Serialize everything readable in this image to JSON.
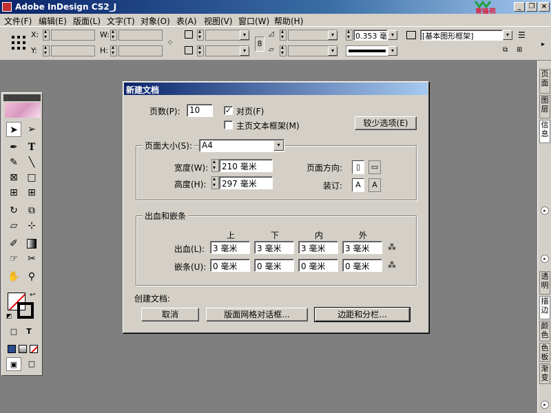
{
  "app": {
    "title": "Adobe InDesign CS2_J",
    "logo": "青锋苑"
  },
  "menu": [
    {
      "label": "文件(F)"
    },
    {
      "label": "编辑(E)"
    },
    {
      "label": "版面(L)"
    },
    {
      "label": "文字(T)"
    },
    {
      "label": "对象(O)"
    },
    {
      "label": "表(A)"
    },
    {
      "label": "视图(V)"
    },
    {
      "label": "窗口(W)"
    },
    {
      "label": "帮助(H)"
    }
  ],
  "control": {
    "x_label": "X:",
    "y_label": "Y:",
    "w_label": "W:",
    "h_label": "H:",
    "stroke_weight": "0.353 毫",
    "frame_style": "[基本图形框架]"
  },
  "dock": {
    "tabs_top": [
      "页面",
      "图层",
      "信息"
    ],
    "tabs_bottom": [
      "透明",
      "描边",
      "颜色",
      "色板",
      "渐变"
    ]
  },
  "dialog": {
    "title": "新建文档",
    "pages_label": "页数(P):",
    "pages_value": "10",
    "facing_label": "对页(F)",
    "facing_checked": "✓",
    "master_text_label": "主页文本框架(M)",
    "fewer_options_label": "较少选项(E)",
    "page_size_label": "页面大小(S):",
    "page_size_value": "A4",
    "width_label": "宽度(W):",
    "width_value": "210 毫米",
    "height_label": "高度(H):",
    "height_value": "297 毫米",
    "orientation_label": "页面方向:",
    "binding_label": "装订:",
    "bleed_group_title": "出血和嵌条",
    "cols": [
      "上",
      "下",
      "内",
      "外"
    ],
    "bleed_label": "出血(L):",
    "bleed_values": [
      "3 毫米",
      "3 毫米",
      "3 毫米",
      "3 毫米"
    ],
    "slug_label": "嵌条(U):",
    "slug_values": [
      "0 毫米",
      "0 毫米",
      "0 毫米",
      "0 毫米"
    ],
    "create_label": "创建文档:",
    "cancel_label": "取消",
    "grid_button_label": "版面网格对话框...",
    "margins_button_label": "边距和分栏..."
  }
}
